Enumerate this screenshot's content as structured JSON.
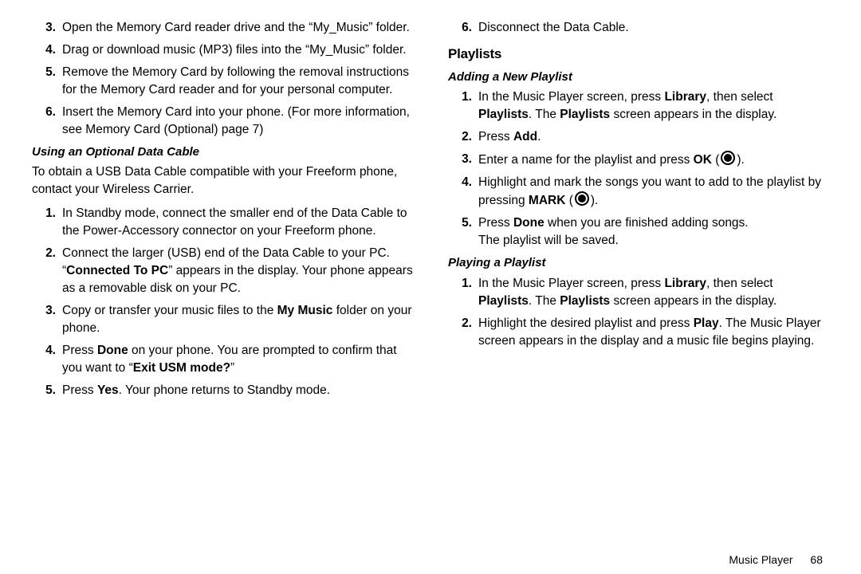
{
  "left": {
    "listA": [
      {
        "n": "3.",
        "t": "Open the Memory Card reader drive and the “My_Music” folder."
      },
      {
        "n": "4.",
        "t": "Drag or download music (MP3) files into the “My_Music” folder."
      },
      {
        "n": "5.",
        "t": "Remove the Memory Card by following the removal instructions for the Memory Card reader and for your personal computer."
      },
      {
        "n": "6.",
        "html": "Insert the Memory Card into your phone. (For more information, see  Memory Card (Optional) page 7)"
      }
    ],
    "h3a": "Using an Optional Data Cable",
    "p1": "To obtain a USB Data Cable compatible with your Freeform phone, contact your Wireless Carrier.",
    "listB": [
      {
        "n": "1.",
        "t": "In Standby mode, connect the smaller end of the Data Cable to the Power-Accessory connector on your Freeform phone."
      },
      {
        "n": "2.",
        "html": "Connect the larger (USB) end of the Data Cable to your PC.<br>“<b>Connected To PC</b>” appears in the display. Your phone appears as a removable disk on your PC."
      },
      {
        "n": "3.",
        "html": "Copy or transfer your music files to the <b>My Music</b> folder on your phone."
      },
      {
        "n": "4.",
        "html": "Press <b>Done</b> on your phone. You are prompted to confirm that you want to “<b>Exit USM mode?</b>”"
      },
      {
        "n": "5.",
        "html": "Press <b>Yes</b>. Your phone returns to Standby mode."
      }
    ]
  },
  "right": {
    "listC": [
      {
        "n": "6.",
        "t": "Disconnect the Data Cable."
      }
    ],
    "h2a": "Playlists",
    "h3a": "Adding a New Playlist",
    "listD": [
      {
        "n": "1.",
        "html": "In the Music Player screen, press <b>Library</b>, then select <b>Playlists</b>. The <b>Playlists</b> screen appears in the display."
      },
      {
        "n": "2.",
        "html": "Press <b>Add</b>."
      },
      {
        "n": "3.",
        "html": "Enter a name for the playlist and press <b>OK</b> (<span class=\"icon-circle\" data-name=\"center-key-icon\" data-interactable=\"false\"></span>)."
      },
      {
        "n": "4.",
        "html": "Highlight and mark the songs you want to add to the playlist by pressing <b>MARK</b> (<span class=\"icon-circle\" data-name=\"center-key-icon\" data-interactable=\"false\"></span>)."
      },
      {
        "n": "5.",
        "html": "Press <b>Done</b> when you are finished adding songs.<br>The playlist will be saved."
      }
    ],
    "h3b": "Playing a Playlist",
    "listE": [
      {
        "n": "1.",
        "html": "In the Music Player screen, press <b>Library</b>, then select <b>Playlists</b>. The <b>Playlists</b> screen appears in the display."
      },
      {
        "n": "2.",
        "html": "Highlight the desired playlist and press <b>Play</b>. The Music Player screen appears in the display and a music file begins playing."
      }
    ]
  },
  "footer": {
    "section": "Music Player",
    "page": "68"
  }
}
